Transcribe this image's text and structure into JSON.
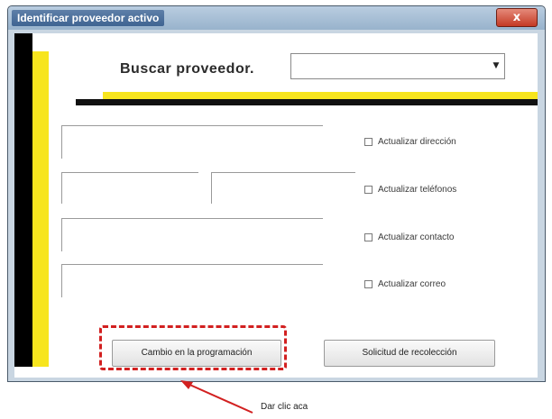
{
  "window": {
    "title": "Identificar proveedor activo",
    "close_glyph": "x"
  },
  "search": {
    "label": "Buscar proveedor.",
    "selected_value": ""
  },
  "fields": {
    "row1": "",
    "row2_left": "",
    "row2_right": "",
    "row3": "",
    "row4": ""
  },
  "checkboxes": [
    {
      "label": "Actualizar dirección",
      "checked": false
    },
    {
      "label": "Actualizar teléfonos",
      "checked": false
    },
    {
      "label": "Actualizar contacto",
      "checked": false
    },
    {
      "label": "Actualizar correo",
      "checked": false
    }
  ],
  "buttons": {
    "cambio": "Cambio en la programación",
    "solicitud": "Solicitud de recolección"
  },
  "annotation": {
    "text": "Dar clic aca"
  },
  "colors": {
    "highlight": "#d22020",
    "accent_yellow": "#f7e51e",
    "close_red": "#c43a25"
  },
  "icons": {
    "dropdown": "chevron-down-icon",
    "close": "close-icon",
    "pointer": "arrow-icon"
  }
}
